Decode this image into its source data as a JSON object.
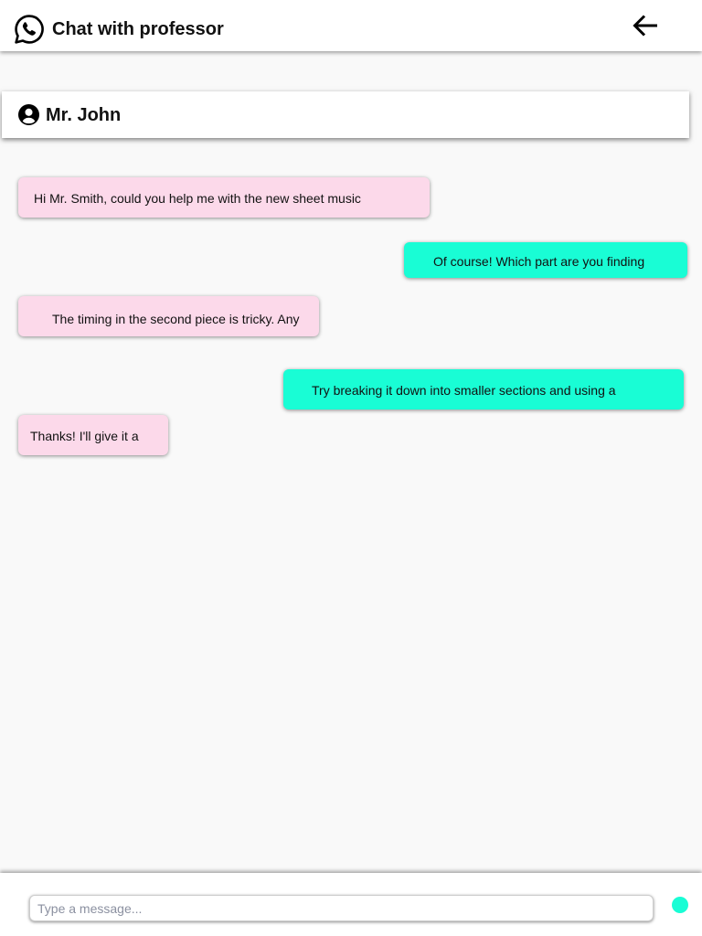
{
  "app": {
    "title": "Chat with professor",
    "logo_icon": "whatsapp-icon",
    "back_icon": "arrow-left-icon"
  },
  "contact": {
    "name": "Mr. John",
    "avatar_icon": "user-circle-icon"
  },
  "messages": [
    {
      "direction": "incoming",
      "text": "Hi Mr. Smith, could you help me with the new sheet music"
    },
    {
      "direction": "outgoing",
      "text": "Of course! Which part are you finding"
    },
    {
      "direction": "incoming",
      "text": "The timing in the second piece is tricky. Any"
    },
    {
      "direction": "outgoing",
      "text": "Try breaking it down into smaller sections and using a"
    },
    {
      "direction": "incoming",
      "text": "Thanks! I'll give it a"
    }
  ],
  "composer": {
    "placeholder": "Type a message...",
    "value": "",
    "send_icon": "send-dot-icon"
  },
  "colors": {
    "background": "#f9f9f9",
    "surface": "#ffffff",
    "incoming_bubble": "#fcd9ea",
    "outgoing_bubble": "#19fdd5",
    "text": "#111111",
    "placeholder": "#8b90a0"
  }
}
